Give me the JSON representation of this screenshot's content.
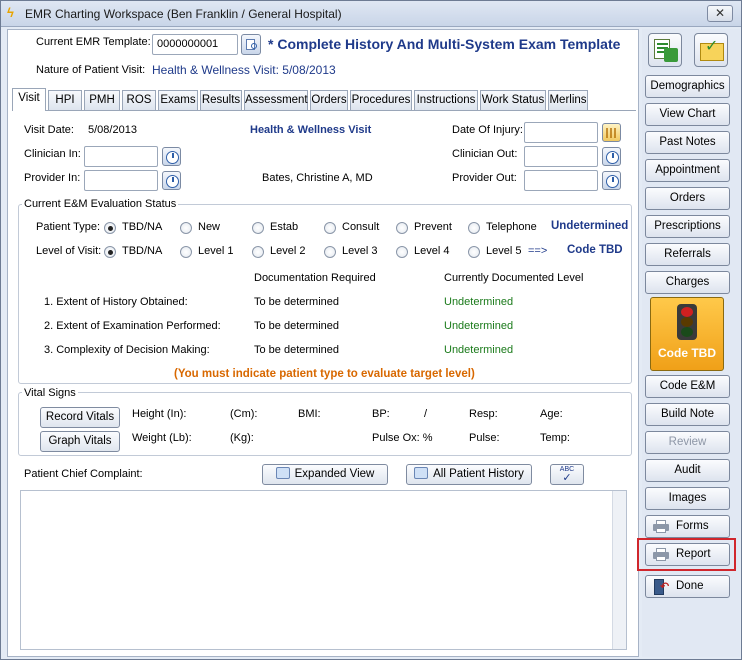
{
  "window": {
    "title": "EMR Charting Workspace (Ben Franklin / General Hospital)",
    "close_glyph": "✕"
  },
  "header": {
    "template_label": "Current EMR Template:",
    "template_id": "0000000001",
    "template_name": "* Complete History And Multi-System Exam Template",
    "visit_label": "Nature of Patient Visit:",
    "visit_value": "Health & Wellness Visit:  5/08/2013"
  },
  "tabs": [
    "Visit",
    "HPI",
    "PMH",
    "ROS",
    "Exams",
    "Results",
    "Assessment",
    "Orders",
    "Procedures",
    "Instructions",
    "Work Status",
    "Merlins"
  ],
  "visit": {
    "visit_date_label": "Visit Date:",
    "visit_date": "5/08/2013",
    "visit_type": "Health & Wellness Visit",
    "date_of_injury_label": "Date Of Injury:",
    "clinician_in_label": "Clinician In:",
    "clinician_out_label": "Clinician Out:",
    "provider_in_label": "Provider In:",
    "provider_out_label": "Provider Out:",
    "provider_name": "Bates, Christine A, MD"
  },
  "em": {
    "group_title": "Current E&M Evaluation Status",
    "patient_type_label": "Patient Type:",
    "patient_types": [
      "TBD/NA",
      "New",
      "Estab",
      "Consult",
      "Prevent",
      "Telephone"
    ],
    "patient_type_status": "Undetermined",
    "level_label": "Level of Visit:",
    "levels": [
      "TBD/NA",
      "Level 1",
      "Level 2",
      "Level 3",
      "Level 4",
      "Level 5"
    ],
    "arrow": "==>",
    "code": "Code TBD",
    "doc_required_header": "Documentation Required",
    "doc_current_header": "Currently Documented Level",
    "rows": [
      {
        "label": "1.  Extent of History Obtained:",
        "required": "To be determined",
        "current": "Undetermined"
      },
      {
        "label": "2.  Extent of Examination Performed:",
        "required": "To be determined",
        "current": "Undetermined"
      },
      {
        "label": "3.  Complexity of Decision Making:",
        "required": "To be determined",
        "current": "Undetermined"
      }
    ],
    "warning": "(You must indicate patient type to evaluate target level)"
  },
  "vitals": {
    "group_title": "Vital Signs",
    "record_btn": "Record Vitals",
    "graph_btn": "Graph Vitals",
    "height": "Height  (In):",
    "cm": "(Cm):",
    "bmi": "BMI:",
    "bp": "BP:",
    "bp_sep": "/",
    "resp": "Resp:",
    "age": "Age:",
    "weight": "Weight (Lb):",
    "kg": "(Kg):",
    "pulse_ox": "Pulse Ox:  %",
    "pulse": "Pulse:",
    "temp": "Temp:"
  },
  "complaint": {
    "label": "Patient Chief Complaint:",
    "expanded_btn": "Expanded View",
    "history_btn": "All Patient History",
    "spell_glyph": "ABC"
  },
  "sidebar": {
    "buttons": [
      "Demographics",
      "View Chart",
      "Past Notes",
      "Appointment",
      "Orders",
      "Prescriptions",
      "Referrals",
      "Charges"
    ],
    "code_label": "Code TBD",
    "buttons2": [
      "Code E&M",
      "Build Note",
      "Review",
      "Audit",
      "Images"
    ],
    "forms": "Forms",
    "report": "Report",
    "done": "Done"
  }
}
